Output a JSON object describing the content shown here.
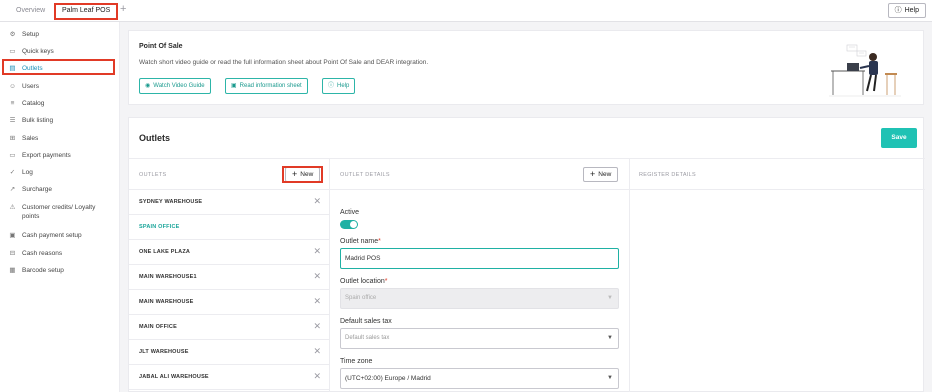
{
  "tabs": {
    "overview": "Overview",
    "active": "Palm Leaf POS",
    "add": "+"
  },
  "help_button": {
    "label": "Help",
    "icon": "help-circle-icon"
  },
  "sidebar": {
    "items": [
      {
        "label": "Setup",
        "icon": "gear-icon",
        "glyph": "⚙"
      },
      {
        "label": "Quick keys",
        "icon": "key-icon",
        "glyph": "▭"
      },
      {
        "label": "Outlets",
        "icon": "store-icon",
        "glyph": "▤"
      },
      {
        "label": "Users",
        "icon": "users-icon",
        "glyph": "☺"
      },
      {
        "label": "Catalog",
        "icon": "list-icon",
        "glyph": "≡"
      },
      {
        "label": "Bulk listing",
        "icon": "bulk-list-icon",
        "glyph": "☰"
      },
      {
        "label": "Sales",
        "icon": "sales-icon",
        "glyph": "⊞"
      },
      {
        "label": "Export payments",
        "icon": "export-icon",
        "glyph": "▭"
      },
      {
        "label": "Log",
        "icon": "log-icon",
        "glyph": "✓"
      },
      {
        "label": "Surcharge",
        "icon": "surcharge-icon",
        "glyph": "↗"
      },
      {
        "label": "Customer credits/ Loyalty points",
        "icon": "credits-icon",
        "glyph": "⚠"
      },
      {
        "label": "Cash payment setup",
        "icon": "cash-icon",
        "glyph": "▣"
      },
      {
        "label": "Cash reasons",
        "icon": "cash-reasons-icon",
        "glyph": "⊟"
      },
      {
        "label": "Barcode setup",
        "icon": "barcode-icon",
        "glyph": "▦"
      }
    ]
  },
  "info": {
    "title": "Point Of Sale",
    "description": "Watch short video guide or read the full information sheet about Point Of Sale and DEAR integration.",
    "buttons": {
      "video": "Watch Video Guide",
      "sheet": "Read information sheet",
      "help": "Help"
    }
  },
  "outlets": {
    "title": "Outlets",
    "save_label": "Save",
    "col_outlets": "OUTLETS",
    "col_details": "OUTLET DETAILS",
    "col_register": "REGISTER DETAILS",
    "new_label": "New",
    "rows": [
      "SYDNEY WAREHOUSE",
      "SPAIN OFFICE",
      "ONE LAKE PLAZA",
      "MAIN WAREHOUSE1",
      "MAIN WAREHOUSE",
      "MAIN OFFICE",
      "JLT WAREHOUSE",
      "JABAL ALI WAREHOUSE"
    ],
    "selected_index": 1
  },
  "form": {
    "active_label": "Active",
    "active_value": true,
    "outlet_name_label": "Outlet name",
    "outlet_name_value": "Madrid POS",
    "outlet_location_label": "Outlet location",
    "outlet_location_value": "Spain office",
    "default_sales_tax_label": "Default sales tax",
    "default_sales_tax_placeholder": "Default sales tax",
    "time_zone_label": "Time zone",
    "time_zone_value": "(UTC+02:00) Europe / Madrid",
    "required_mark": "*"
  },
  "colors": {
    "accent": "#1fc2b4",
    "highlight": "#e13a26",
    "link": "#1a8fb8"
  }
}
